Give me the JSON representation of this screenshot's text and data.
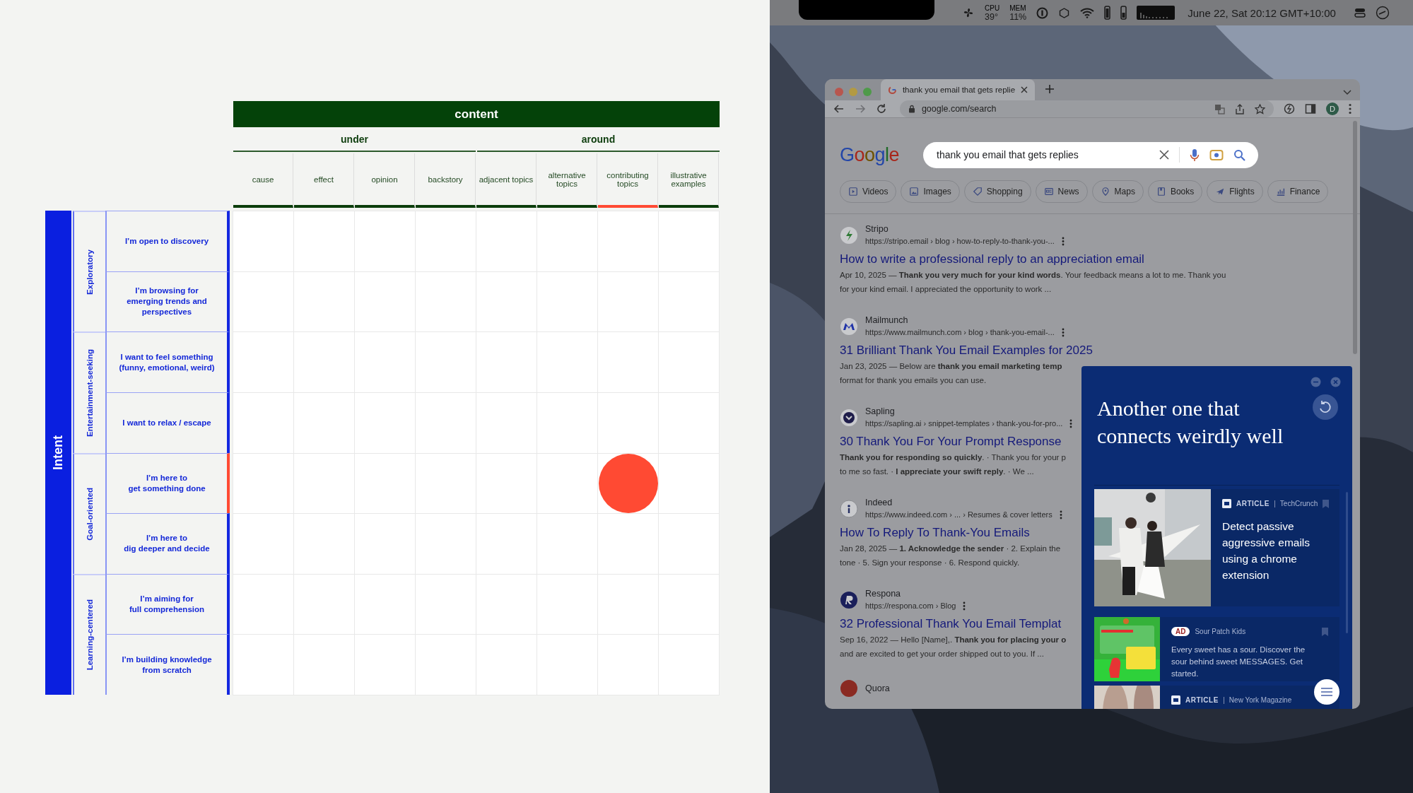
{
  "matrix": {
    "header": "content",
    "column_groups": [
      {
        "label": "under",
        "columns": [
          {
            "label": "cause",
            "selected": false
          },
          {
            "label": "effect",
            "selected": false
          },
          {
            "label": "opinion",
            "selected": false
          },
          {
            "label": "backstory",
            "selected": false
          }
        ]
      },
      {
        "label": "around",
        "columns": [
          {
            "label": "adjacent topics",
            "selected": false
          },
          {
            "label": "alternative topics",
            "selected": false
          },
          {
            "label": "contributing topics",
            "selected": true
          },
          {
            "label": "illustrative examples",
            "selected": false
          }
        ]
      }
    ],
    "axis_label": "Intent",
    "row_groups": [
      {
        "label": "Exploratory",
        "rows": [
          {
            "label": "I’m open to discovery",
            "selected": false
          },
          {
            "label": "I’m browsing for\nemerging trends and\nperspectives",
            "selected": false
          }
        ]
      },
      {
        "label": "Entertainment-seeking",
        "rows": [
          {
            "label": "I want to feel something\n(funny, emotional, weird)",
            "selected": false
          },
          {
            "label": "I want to relax / escape",
            "selected": false
          }
        ]
      },
      {
        "label": "Goal-oriented",
        "rows": [
          {
            "label": "I’m here to\nget something done",
            "selected": true
          },
          {
            "label": "I’m here to\ndig deeper and decide",
            "selected": false
          }
        ]
      },
      {
        "label": "Learning-centered",
        "rows": [
          {
            "label": "I’m aiming for\nfull comprehension",
            "selected": false
          },
          {
            "label": "I’m building knowledge\nfrom scratch",
            "selected": false
          }
        ]
      }
    ]
  },
  "menu_bar": {
    "cpu_label": "CPU",
    "cpu_value": "39°",
    "mem_label": "MEM",
    "mem_value": "11%",
    "clock": "June 22, Sat 20:12 GMT+10:00"
  },
  "browser": {
    "tab_title": "thank you email that gets replie",
    "address": "google.com/search",
    "avatar": "D",
    "logo": "Google",
    "search_query": "thank you email that gets replies",
    "filters": [
      "Videos",
      "Images",
      "Shopping",
      "News",
      "Maps",
      "Books",
      "Flights",
      "Finance"
    ],
    "results": [
      {
        "site": "Stripo",
        "url": "https://stripo.email › blog › how-to-reply-to-thank-you-...",
        "title": "How to write a professional reply to an appreciation email",
        "snippet_lines": [
          "Apr 10, 2025 — **Thank you very much for your kind words**. Your feedback means a lot to me. Thank you",
          "for your kind email. I appreciated the opportunity to work ..."
        ]
      },
      {
        "site": "Mailmunch",
        "url": "https://www.mailmunch.com › blog › thank-you-email-...",
        "title": "31 Brilliant Thank You Email Examples for 2025",
        "snippet_lines": [
          "Jan 23, 2025 — Below are **thank you email marketing temp**",
          "format for thank you emails you can use."
        ]
      },
      {
        "site": "Sapling",
        "url": "https://sapling.ai › snippet-templates › thank-you-for-pro...",
        "title": "30 Thank You For Your Prompt Response",
        "snippet_lines": [
          "**Thank you for responding so quickly**. · Thank you for your p",
          "to me so fast. · **I appreciate your swift reply**. · We ..."
        ]
      },
      {
        "site": "Indeed",
        "url": "https://www.indeed.com › ... › Resumes & cover letters",
        "title": "How To Reply To Thank-You Emails",
        "snippet_lines": [
          "Jan 28, 2025 — **1. Acknowledge the sender** · 2. Explain the",
          "tone · 5. Sign your response · 6. Respond quickly."
        ]
      },
      {
        "site": "Respona",
        "url": "https://respona.com › Blog",
        "title": "32 Professional Thank You Email Templat",
        "snippet_lines": [
          "Sep 16, 2022 — Hello [Name],. **Thank you for placing your o**",
          "and are excited to get your order shipped out to you. If ..."
        ]
      },
      {
        "site": "Quora"
      }
    ]
  },
  "panel": {
    "title": "Another one that connects weirdly well",
    "cards": [
      {
        "kind": "article",
        "type_label": "ARTICLE",
        "source": "TechCrunch",
        "title": "Detect passive aggressive emails using a chrome extension"
      },
      {
        "kind": "ad",
        "type_label": "AD",
        "source": "Sour Patch Kids",
        "body": "Every sweet has a sour. Discover the sour behind sweet MESSAGES. Get started."
      },
      {
        "kind": "article",
        "type_label": "ARTICLE",
        "source": "New York Magazine"
      }
    ]
  }
}
